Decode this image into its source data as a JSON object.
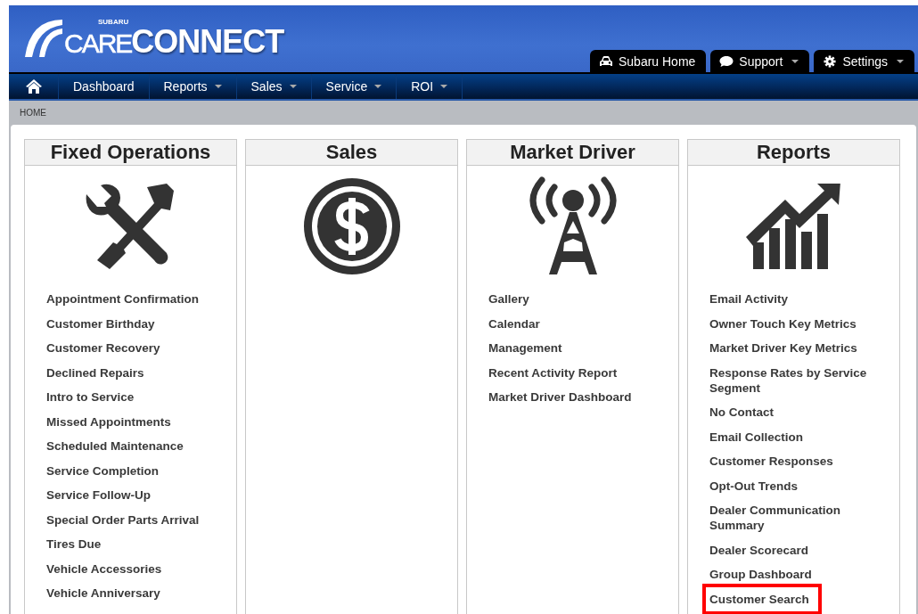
{
  "logo": {
    "brand": "SUBARU",
    "light": "CARE",
    "bold": "CONNECT"
  },
  "top_tabs": [
    {
      "label": "Subaru Home",
      "dropdown": false
    },
    {
      "label": "Support",
      "dropdown": true
    },
    {
      "label": "Settings",
      "dropdown": true
    }
  ],
  "nav": [
    {
      "label": "Dashboard",
      "dropdown": false
    },
    {
      "label": "Reports",
      "dropdown": true
    },
    {
      "label": "Sales",
      "dropdown": true
    },
    {
      "label": "Service",
      "dropdown": true
    },
    {
      "label": "ROI",
      "dropdown": true
    }
  ],
  "breadcrumb": "HOME",
  "columns": [
    {
      "title": "Fixed Operations",
      "items": [
        {
          "label": "Appointment Confirmation",
          "highlighted": false
        },
        {
          "label": "Customer Birthday",
          "highlighted": false
        },
        {
          "label": "Customer Recovery",
          "highlighted": false
        },
        {
          "label": "Declined Repairs",
          "highlighted": false
        },
        {
          "label": "Intro to Service",
          "highlighted": false
        },
        {
          "label": "Missed Appointments",
          "highlighted": false
        },
        {
          "label": "Scheduled Maintenance",
          "highlighted": false
        },
        {
          "label": "Service Completion",
          "highlighted": false
        },
        {
          "label": "Service Follow-Up",
          "highlighted": false
        },
        {
          "label": "Special Order Parts Arrival",
          "highlighted": false
        },
        {
          "label": "Tires Due",
          "highlighted": false
        },
        {
          "label": "Vehicle Accessories",
          "highlighted": false
        },
        {
          "label": "Vehicle Anniversary",
          "highlighted": false
        }
      ]
    },
    {
      "title": "Sales"
    },
    {
      "title": "Market Driver",
      "items": [
        {
          "label": "Gallery",
          "highlighted": false
        },
        {
          "label": "Calendar",
          "highlighted": false
        },
        {
          "label": "Management",
          "highlighted": false
        },
        {
          "label": "Recent Activity Report",
          "highlighted": false
        },
        {
          "label": "Market Driver Dashboard",
          "highlighted": false
        }
      ]
    },
    {
      "title": "Reports",
      "items": [
        {
          "label": "Email Activity",
          "highlighted": false
        },
        {
          "label": "Owner Touch Key Metrics",
          "highlighted": false
        },
        {
          "label": "Market Driver Key Metrics",
          "highlighted": false
        },
        {
          "label": "Response Rates by Service Segment",
          "highlighted": false
        },
        {
          "label": "No Contact",
          "highlighted": false
        },
        {
          "label": "Email Collection",
          "highlighted": false
        },
        {
          "label": "Customer Responses",
          "highlighted": false
        },
        {
          "label": "Opt-Out Trends",
          "highlighted": false
        },
        {
          "label": "Dealer Communication Summary",
          "highlighted": false
        },
        {
          "label": "Dealer Scorecard",
          "highlighted": false
        },
        {
          "label": "Group Dashboard",
          "highlighted": false
        },
        {
          "label": "Customer Search",
          "highlighted": true
        }
      ]
    }
  ]
}
